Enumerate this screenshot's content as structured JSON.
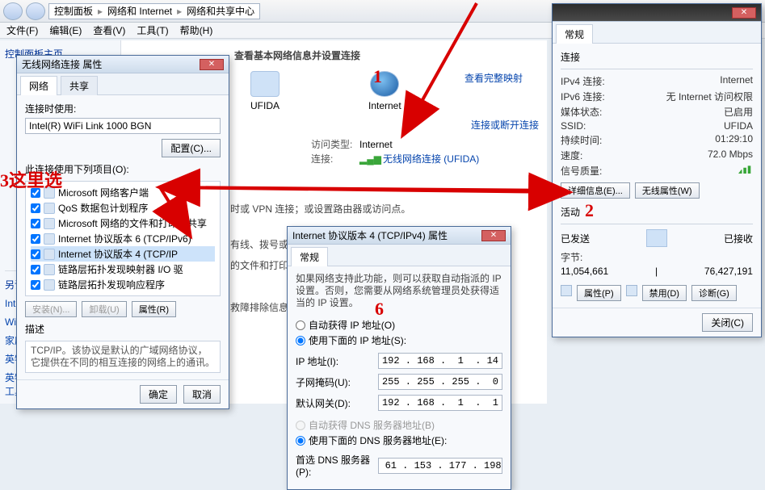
{
  "breadcrumb": {
    "a": "控制面板",
    "b": "网络和 Internet",
    "c": "网络和共享中心"
  },
  "menus": {
    "file": "文件(F)",
    "edit": "编辑(E)",
    "view": "查看(V)",
    "tools": "工具(T)",
    "help": "帮助(H)"
  },
  "left": {
    "head": "控制面板主页",
    "seeAlso": "另请参阅",
    "items": [
      "Internet 选项",
      "Windows 防火墙",
      "家庭组",
      "英特尔(R) My WiFi 技术",
      "英特尔(R) PROSet/无线工具"
    ]
  },
  "main": {
    "section": "查看基本网络信息并设置连接",
    "mapLink": "查看完整映射",
    "node1": "UFIDA",
    "node2": "Internet",
    "connLink": "连接或断开连接",
    "accessLbl": "访问类型:",
    "accessVal": "Internet",
    "connLbl": "连接:",
    "connVal": "无线网络连接 (UFIDA)",
    "vpnLine": "时或 VPN 连接；或设置路由器或访问点。",
    "l1": "有线、拨号或 VP",
    "l2": "的文件和打印机",
    "l3": "救障排除信息。"
  },
  "wifiProps": {
    "title": "无线网络连接 属性",
    "tab1": "网络",
    "tab2": "共享",
    "connUsing": "连接时使用:",
    "adapter": "Intel(R) WiFi Link 1000 BGN",
    "cfg": "配置(C)...",
    "listHead": "此连接使用下列项目(O):",
    "items": [
      "Microsoft 网络客户端",
      "QoS 数据包计划程序",
      "Microsoft 网络的文件和打印机共享",
      "Internet 协议版本 6 (TCP/IPv6)",
      "Internet 协议版本 4 (TCP/IP",
      "链路层拓扑发现映射器 I/O 驱",
      "链路层拓扑发现响应程序"
    ],
    "install": "安装(N)...",
    "uninstall": "卸载(U)",
    "props": "属性(R)",
    "descLbl": "描述",
    "desc": "TCP/IP。该协议是默认的广域网络协议，它提供在不同的相互连接的网络上的通讯。",
    "ok": "确定",
    "cancel": "取消"
  },
  "status": {
    "tab": "常规",
    "connHead": "连接",
    "ipv4l": "IPv4 连接:",
    "ipv4v": "Internet",
    "ipv6l": "IPv6 连接:",
    "ipv6v": "无 Internet 访问权限",
    "mediaL": "媒体状态:",
    "mediaV": "已启用",
    "ssidL": "SSID:",
    "ssidV": "UFIDA",
    "durL": "持续时间:",
    "durV": "01:29:10",
    "spdL": "速度:",
    "spdV": "72.0 Mbps",
    "sigL": "信号质量:",
    "detailBtn": "详细信息(E)...",
    "wpropBtn": "无线属性(W)",
    "actHead": "活动",
    "sent": "已发送",
    "recv": "已接收",
    "bytesL": "字节:",
    "sentV": "11,054,661",
    "recvV": "76,427,191",
    "propBtn": "属性(P)",
    "disableBtn": "禁用(D)",
    "diagBtn": "诊断(G)",
    "closeBtn": "关闭(C)"
  },
  "ipv4": {
    "title": "Internet 协议版本 4 (TCP/IPv4) 属性",
    "tab": "常规",
    "blurb": "如果网络支持此功能，则可以获取自动指派的 IP 设置。否则，您需要从网络系统管理员处获得适当的 IP 设置。",
    "autoIp": "自动获得 IP 地址(O)",
    "manIp": "使用下面的 IP 地址(S):",
    "ipL": "IP 地址(I):",
    "ipV": "192 . 168 .  1  . 14",
    "maskL": "子网掩码(U):",
    "maskV": "255 . 255 . 255 .  0",
    "gwL": "默认网关(D):",
    "gwV": "192 . 168 .  1  .  1",
    "autoDns": "自动获得 DNS 服务器地址(B)",
    "manDns": "使用下面的 DNS 服务器地址(E):",
    "dns1L": "首选 DNS 服务器(P):",
    "dns1V": " 61 . 153 . 177 . 198"
  },
  "notes": {
    "n1": "1",
    "n2": "2",
    "n3": "3这里选",
    "n6": "6"
  }
}
